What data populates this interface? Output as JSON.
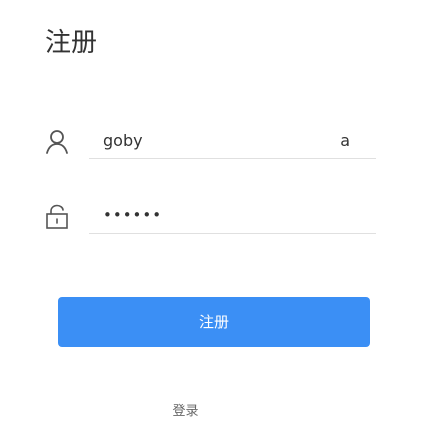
{
  "page": {
    "title": "注册"
  },
  "form": {
    "username": {
      "icon": "user-icon",
      "value": "goby",
      "suffix": "a"
    },
    "password": {
      "icon": "lock-icon",
      "value": "••••••"
    },
    "submit_label": "注册"
  },
  "footer": {
    "login_link": "登录"
  },
  "colors": {
    "primary": "#3b8ff5",
    "underline": "#e0e0e0",
    "text": "#333333"
  }
}
